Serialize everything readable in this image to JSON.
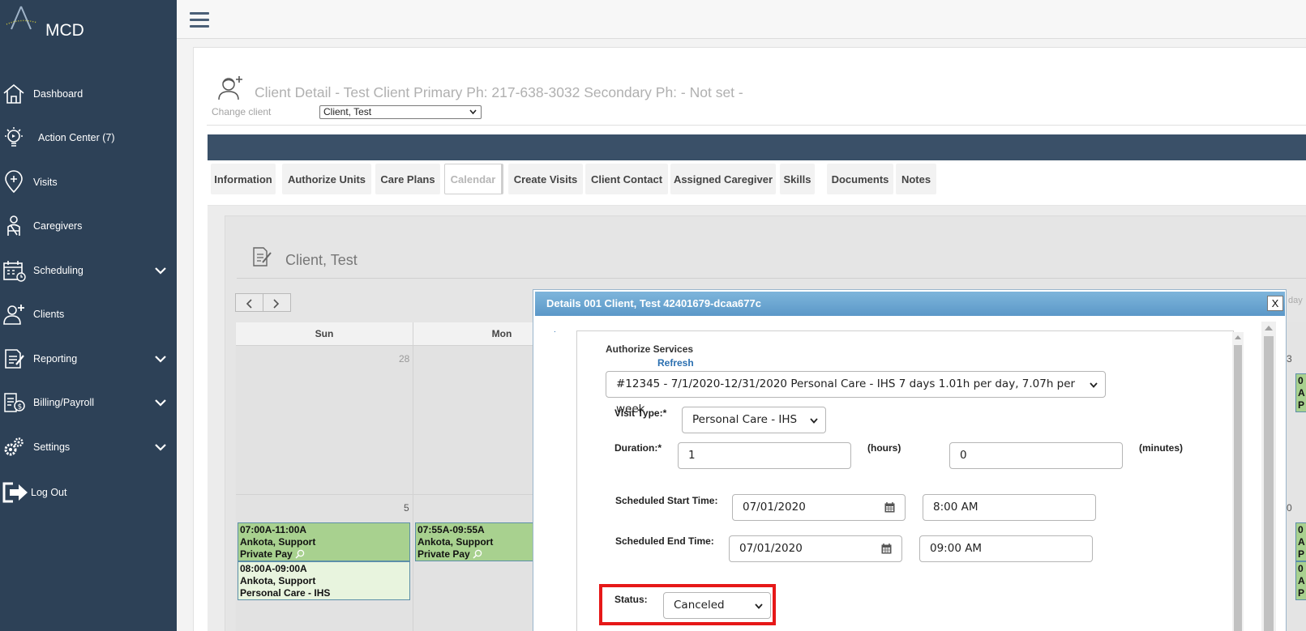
{
  "app": {
    "brand": "MCD"
  },
  "sidebar": {
    "items": [
      {
        "label": "Dashboard",
        "icon": "home-icon"
      },
      {
        "label": "Action Center (7)",
        "icon": "lightbulb-icon"
      },
      {
        "label": "Visits",
        "icon": "map-pin-icon"
      },
      {
        "label": "Caregivers",
        "icon": "caregiver-icon"
      },
      {
        "label": "Scheduling",
        "icon": "calendar-icon",
        "expandable": true
      },
      {
        "label": "Clients",
        "icon": "client-icon"
      },
      {
        "label": "Reporting",
        "icon": "report-icon",
        "expandable": true
      },
      {
        "label": "Billing/Payroll",
        "icon": "billing-icon",
        "expandable": true
      },
      {
        "label": "Settings",
        "icon": "gears-icon",
        "expandable": true
      },
      {
        "label": "Log Out",
        "icon": "logout-icon"
      }
    ]
  },
  "header": {
    "title": "Client Detail - Test Client Primary Ph: 217-638-3032 Secondary Ph: - Not set -",
    "change_client_label": "Change client",
    "change_client_value": "Client, Test"
  },
  "tabs": [
    {
      "label": "Information"
    },
    {
      "label": "Authorize Units"
    },
    {
      "label": "Care Plans"
    },
    {
      "label": "Calendar",
      "active": true
    },
    {
      "label": "Create Visits"
    },
    {
      "label": "Client Contact"
    },
    {
      "label": "Assigned Caregiver"
    },
    {
      "label": "Skills"
    },
    {
      "label": "Documents"
    },
    {
      "label": "Notes"
    }
  ],
  "calendar": {
    "title": "Client, Test",
    "day_headers": [
      "Sun",
      "Mon"
    ],
    "week1_days": [
      "28",
      "3"
    ],
    "week2_days": [
      "5",
      "0"
    ],
    "right_edge_header": "day",
    "right_edge_fragments": [
      "0",
      "A",
      "P"
    ],
    "events": {
      "sun_1": {
        "time": "07:00A-11:00A",
        "name": "Ankota, Support",
        "type": "Private Pay"
      },
      "sun_2": {
        "time": "08:00A-09:00A",
        "name": "Ankota, Support",
        "type": "Personal Care - IHS"
      },
      "mon_1": {
        "time": "07:55A-09:55A",
        "name": "Ankota, Support",
        "type": "Private Pay"
      }
    }
  },
  "modal": {
    "title": "Details 001 Client, Test 42401679-dcaa677c",
    "close_label": "X",
    "dot": ".",
    "authorize_label": "Authorize Services",
    "refresh_label": "Refresh",
    "authorization_value": "#12345 - 7/1/2020-12/31/2020 Personal Care - IHS 7 days 1.01h per day, 7.07h per week",
    "visit_type_label": "Visit Type:*",
    "visit_type_value": "Personal Care - IHS",
    "duration_label": "Duration:*",
    "duration_hours": "1",
    "hours_label": "(hours)",
    "duration_minutes": "0",
    "minutes_label": "(minutes)",
    "start_label": "Scheduled Start Time:",
    "start_date": "07/01/2020",
    "start_time": "8:00 AM",
    "end_label": "Scheduled End Time:",
    "end_date": "07/01/2020",
    "end_time": "09:00 AM",
    "status_label": "Status:",
    "status_value": "Canceled"
  },
  "colors": {
    "sidebar_bg": "#2d4157",
    "event_green": "#a8d18f",
    "event_light": "#e8f4de",
    "modal_header": "#6aa6d2",
    "highlight": "#e61818"
  }
}
